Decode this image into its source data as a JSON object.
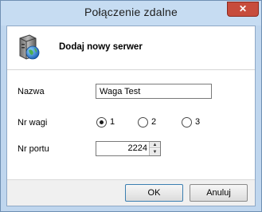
{
  "window": {
    "title": "Połączenie zdalne",
    "close_label": "✕"
  },
  "header": {
    "title": "Dodaj nowy serwer",
    "icon": "server-globe-icon"
  },
  "form": {
    "name_label": "Nazwa",
    "name_value": "Waga Test",
    "scale_label": "Nr wagi",
    "scale_options": [
      {
        "label": "1",
        "selected": true
      },
      {
        "label": "2",
        "selected": false
      },
      {
        "label": "3",
        "selected": false
      }
    ],
    "port_label": "Nr portu",
    "port_value": "2224"
  },
  "buttons": {
    "ok": "OK",
    "cancel": "Anuluj"
  }
}
